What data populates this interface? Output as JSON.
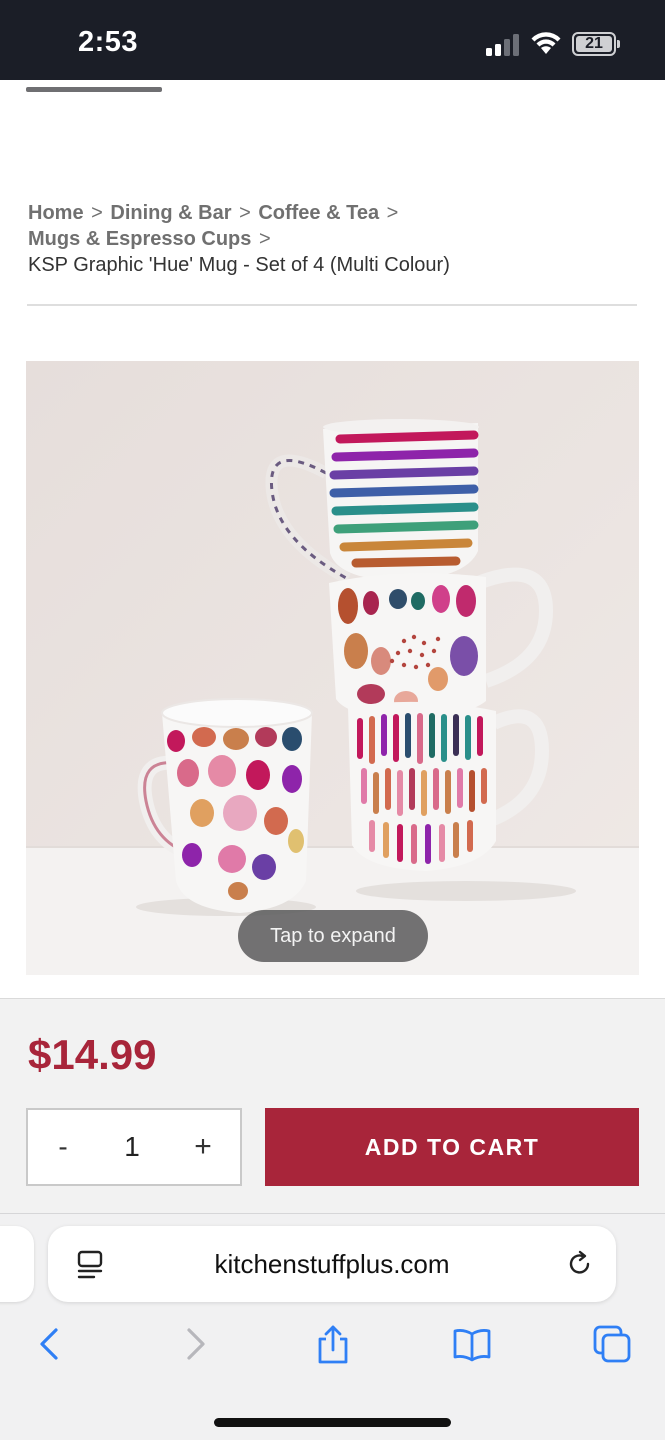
{
  "status_bar": {
    "time": "2:53",
    "battery": "21",
    "icons": [
      "signal-icon",
      "wifi-icon",
      "battery-icon"
    ]
  },
  "breadcrumb": {
    "links": [
      "Home",
      "Dining & Bar",
      "Coffee & Tea",
      "Mugs & Espresso Cups"
    ],
    "separator": ">",
    "current": "KSP Graphic 'Hue' Mug - Set of 4 (Multi Colour)"
  },
  "product": {
    "image_overlay": "Tap to expand",
    "price": "$14.99",
    "quantity": {
      "minus_label": "-",
      "value": "1",
      "plus_label": "+"
    },
    "add_to_cart_label": "ADD TO CART"
  },
  "browser": {
    "url": "kitchenstuffplus.com",
    "toolbar_icons": [
      "back-icon",
      "forward-icon",
      "share-icon",
      "bookmarks-icon",
      "tabs-icon"
    ]
  },
  "colors": {
    "accent": "#a8253a",
    "status_bar_bg": "#1b1e27",
    "safari_blue": "#2f7ff5"
  }
}
